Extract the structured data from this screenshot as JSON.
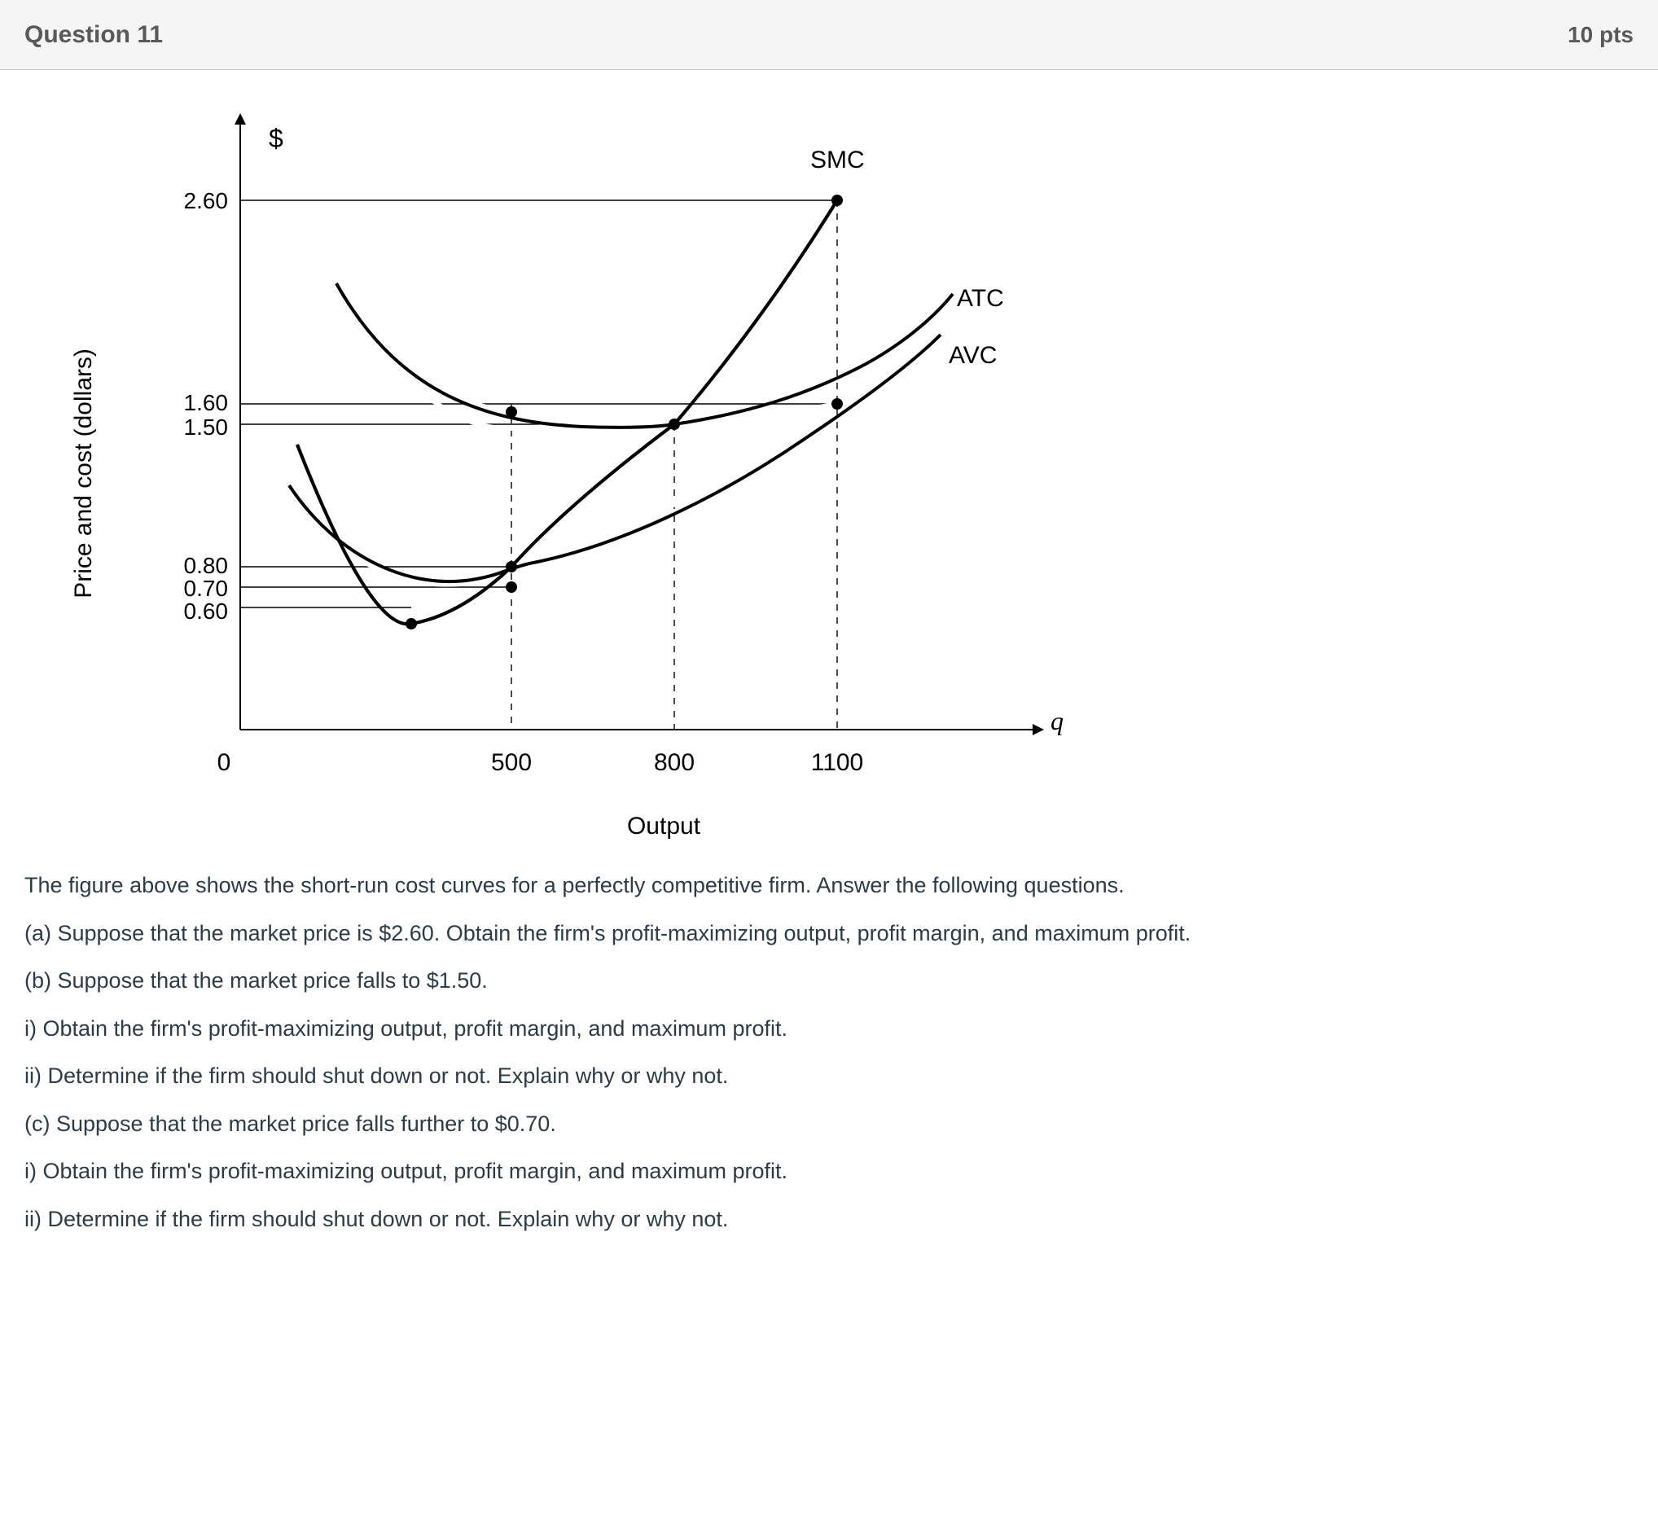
{
  "header": {
    "title": "Question 11",
    "points": "10 pts"
  },
  "axis": {
    "ylabel": "Price and cost (dollars)",
    "xlabel": "Output",
    "currency": "$",
    "qlabel": "q"
  },
  "curves": {
    "smc": "SMC",
    "atc": "ATC",
    "avc": "AVC"
  },
  "yticks": {
    "t260": "2.60",
    "t160": "1.60",
    "t150": "1.50",
    "t080": "0.80",
    "t070": "0.70",
    "t060": "0.60"
  },
  "xticks": {
    "x0": "0",
    "x500": "500",
    "x800": "800",
    "x1100": "1100"
  },
  "prose": {
    "p1": "The figure above shows the short-run cost curves for a perfectly competitive firm. Answer the following questions.",
    "p2": "(a) Suppose that the market price is $2.60. Obtain the firm's profit-maximizing output, profit margin, and maximum profit.",
    "p3": "(b) Suppose that the market price falls to $1.50.",
    "p3i": "i) Obtain the firm's profit-maximizing output, profit margin, and maximum profit.",
    "p3ii": "ii) Determine if the firm should shut down or not. Explain why or why not.",
    "p4": "(c) Suppose that the market price falls further to $0.70.",
    "p4i": "i) Obtain the firm's profit-maximizing output, profit margin, and maximum profit.",
    "p4ii": "ii) Determine if the firm should shut down or not. Explain why or why not."
  },
  "chart_data": {
    "type": "line",
    "title": "Short-run cost curves for a perfectly competitive firm",
    "xlabel": "Output",
    "ylabel": "Price and cost (dollars)",
    "x_ticks": [
      0,
      500,
      800,
      1100
    ],
    "y_ticks": [
      0.6,
      0.7,
      0.8,
      1.5,
      1.6,
      2.6
    ],
    "series": [
      {
        "name": "SMC",
        "description": "Short-run marginal cost, U-shaped, rises steeply; passes through (500,0.80), (800,1.50), (1100,2.60); min near q≈350 at ≈$0.60"
      },
      {
        "name": "ATC",
        "description": "Average total cost, U-shaped; passes through (500,1.60), (800,1.50), (1100,1.60); minimum at q=800 where SMC intersects at $1.50"
      },
      {
        "name": "AVC",
        "description": "Average variable cost, U-shaped below ATC; passes through (500,0.80); minimum at q=500 where SMC intersects at $0.80"
      }
    ],
    "key_points": [
      {
        "q": 500,
        "SMC": 0.8,
        "AVC": 0.8,
        "ATC": 1.6,
        "note": "SMC=AVC min"
      },
      {
        "q": 500,
        "SMC": 0.7,
        "note": "SMC at $0.70 approx"
      },
      {
        "q": 800,
        "SMC": 1.5,
        "ATC": 1.5,
        "note": "SMC=ATC min"
      },
      {
        "q": 1100,
        "SMC": 2.6,
        "ATC": 1.6,
        "note": "profit-max at P=2.60"
      }
    ],
    "horizontal_price_lines": [
      2.6,
      1.6,
      1.5,
      0.8,
      0.7,
      0.6
    ]
  }
}
